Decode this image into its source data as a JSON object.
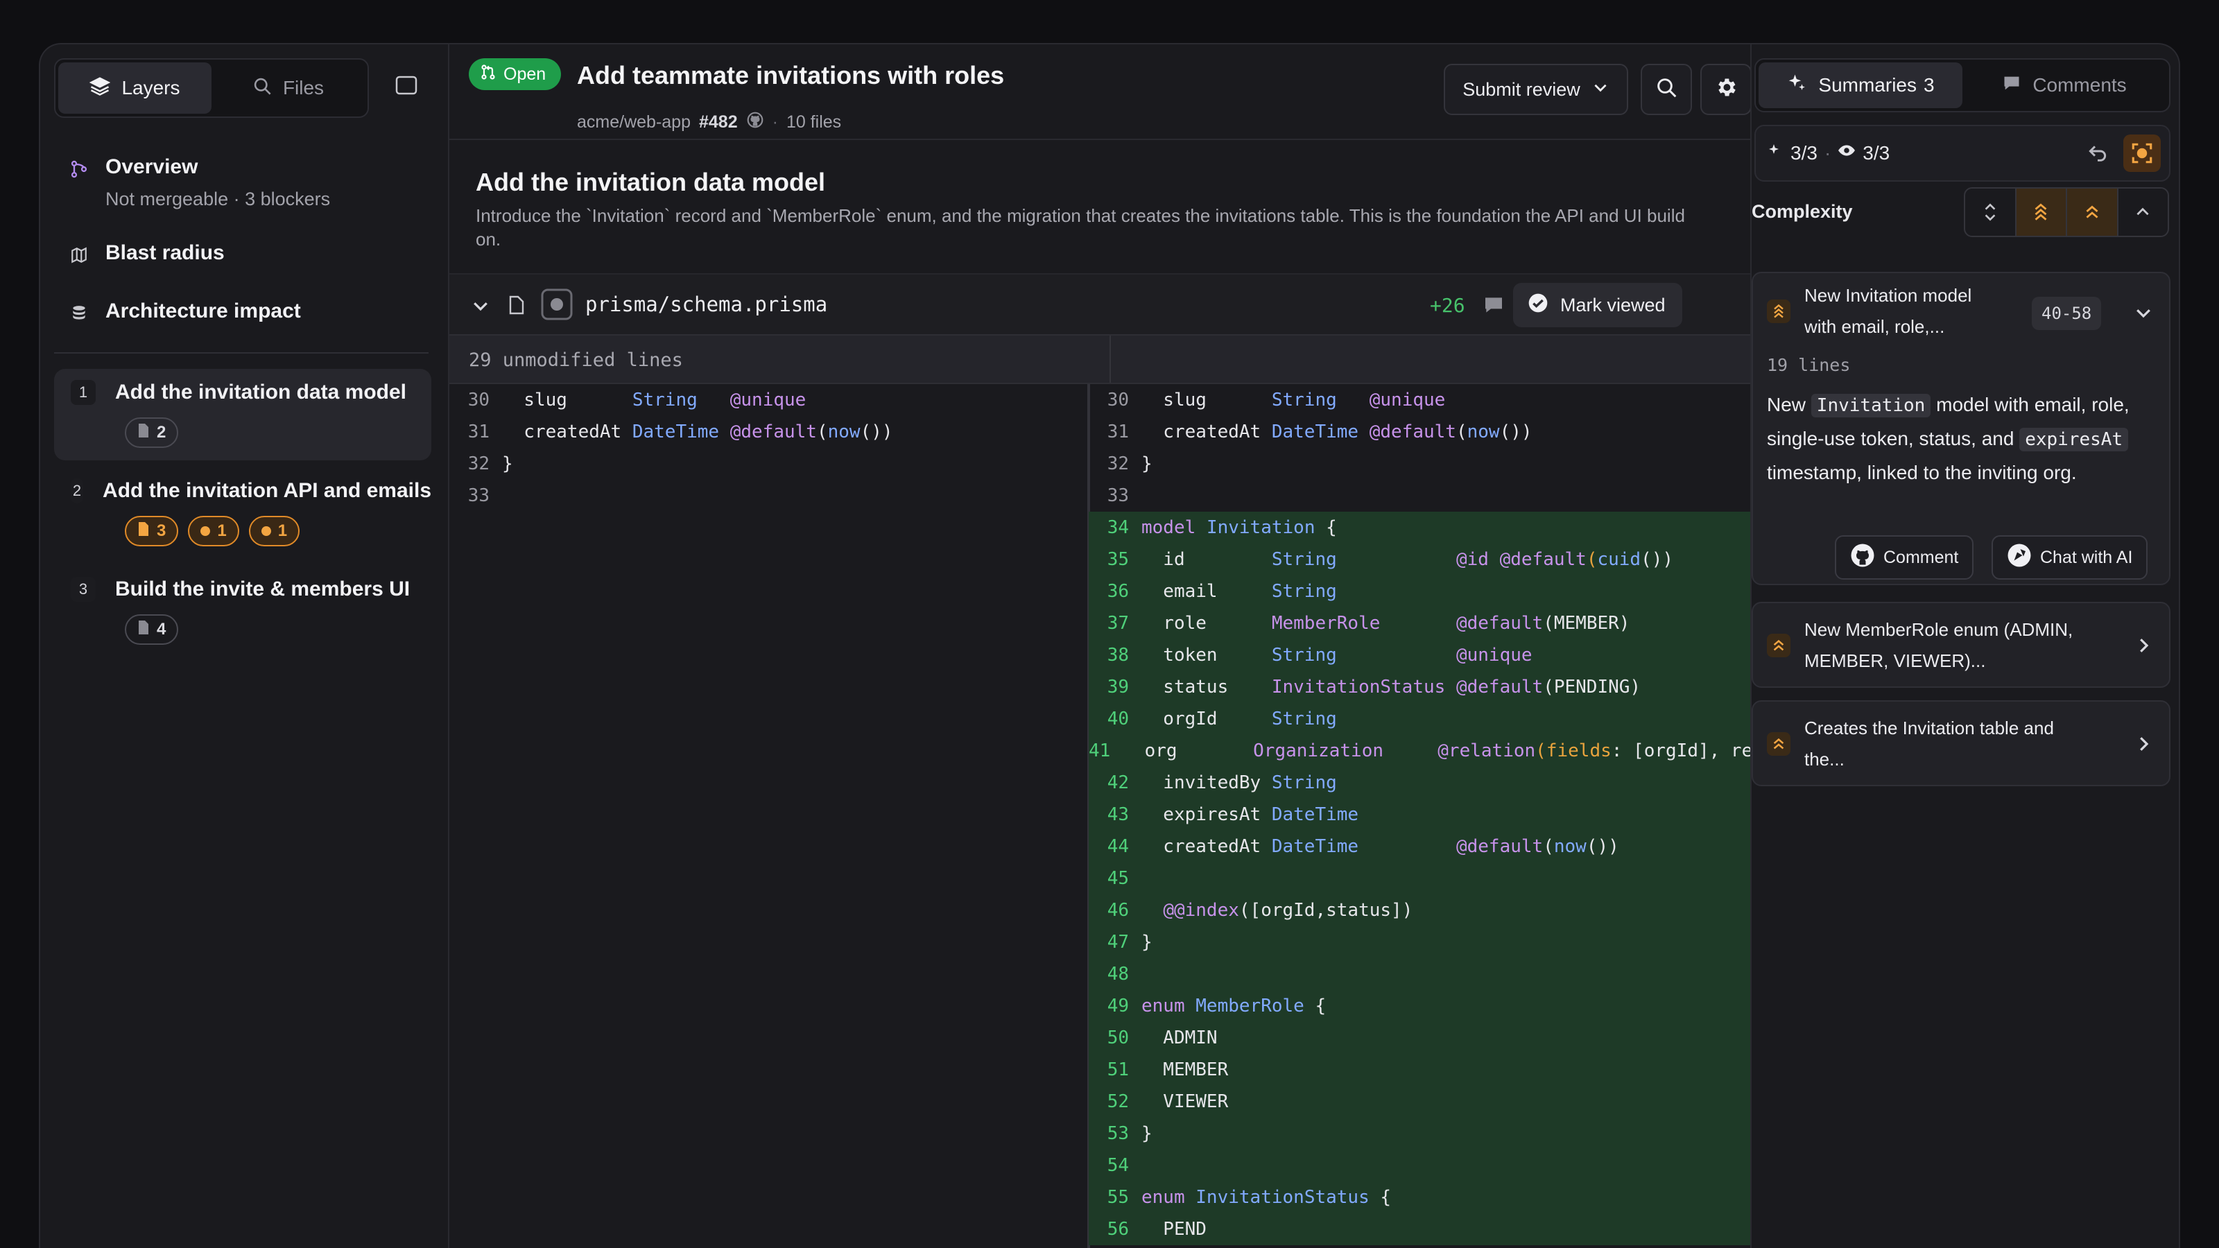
{
  "sidebar": {
    "tabs": [
      {
        "label": "Layers",
        "icon": "layers-icon"
      },
      {
        "label": "Files",
        "icon": "search-icon"
      }
    ],
    "nav": [
      {
        "title": "Overview",
        "subtitle": "Not mergeable · 3 blockers",
        "icon": "git-branch-icon"
      },
      {
        "title": "Blast radius",
        "icon": "map-icon"
      },
      {
        "title": "Architecture impact",
        "icon": "database-icon"
      }
    ],
    "layers": [
      {
        "num": "1",
        "title": "Add the invitation data model",
        "file_count": "2"
      },
      {
        "num": "2",
        "title": "Add the invitation API and emails",
        "file_count": "3",
        "warn_a": "1",
        "warn_b": "1"
      },
      {
        "num": "3",
        "title": "Build the invite & members UI",
        "file_count": "4"
      }
    ]
  },
  "header": {
    "status": "Open",
    "title": "Add teammate invitations with roles",
    "repo": "acme/web-app",
    "pr_number": "#482",
    "files": "10 files",
    "submit_label": "Submit review"
  },
  "section": {
    "title": "Add the invitation data model",
    "description": "Introduce the `Invitation` record and `MemberRole` enum, and the migration that creates the invitations table. This is the foundation the API and UI build on."
  },
  "file": {
    "path": "prisma/schema.prisma",
    "additions": "+26",
    "mark_viewed": "Mark viewed",
    "unmodified": "29 unmodified lines"
  },
  "diff_left": [
    {
      "n": "30",
      "parts": [
        [
          "p",
          "  slug      "
        ],
        [
          "t",
          "String"
        ],
        [
          "p",
          "   "
        ],
        [
          "a",
          "@unique"
        ]
      ]
    },
    {
      "n": "31",
      "parts": [
        [
          "p",
          "  createdAt "
        ],
        [
          "t",
          "DateTime"
        ],
        [
          "p",
          " "
        ],
        [
          "a",
          "@default"
        ],
        [
          "p",
          "("
        ],
        [
          "f",
          "now"
        ],
        [
          "p",
          "())"
        ]
      ]
    },
    {
      "n": "32",
      "parts": [
        [
          "p",
          "}"
        ]
      ]
    },
    {
      "n": "33",
      "parts": [
        [
          "p",
          ""
        ]
      ]
    }
  ],
  "diff_right": [
    {
      "n": "30",
      "add": false,
      "parts": [
        [
          "p",
          "  slug      "
        ],
        [
          "t",
          "String"
        ],
        [
          "p",
          "   "
        ],
        [
          "a",
          "@unique"
        ]
      ]
    },
    {
      "n": "31",
      "add": false,
      "parts": [
        [
          "p",
          "  createdAt "
        ],
        [
          "t",
          "DateTime"
        ],
        [
          "p",
          " "
        ],
        [
          "a",
          "@default"
        ],
        [
          "p",
          "("
        ],
        [
          "f",
          "now"
        ],
        [
          "p",
          "())"
        ]
      ]
    },
    {
      "n": "32",
      "add": false,
      "parts": [
        [
          "p",
          "}"
        ]
      ]
    },
    {
      "n": "33",
      "add": false,
      "parts": [
        [
          "p",
          ""
        ]
      ]
    },
    {
      "n": "34",
      "add": true,
      "parts": [
        [
          "k",
          "model"
        ],
        [
          "p",
          " "
        ],
        [
          "t",
          "Invitation"
        ],
        [
          "p",
          " {"
        ]
      ]
    },
    {
      "n": "35",
      "add": true,
      "parts": [
        [
          "p",
          "  id        "
        ],
        [
          "t",
          "String"
        ],
        [
          "p",
          "           "
        ],
        [
          "a",
          "@id"
        ],
        [
          "p",
          " "
        ],
        [
          "a",
          "@default"
        ],
        [
          "o",
          "("
        ],
        [
          "f",
          "cuid"
        ],
        [
          "p",
          "())"
        ]
      ]
    },
    {
      "n": "36",
      "add": true,
      "parts": [
        [
          "p",
          "  email     "
        ],
        [
          "t",
          "String"
        ]
      ]
    },
    {
      "n": "37",
      "add": true,
      "parts": [
        [
          "p",
          "  role      "
        ],
        [
          "k",
          "MemberRole"
        ],
        [
          "p",
          "       "
        ],
        [
          "a",
          "@default"
        ],
        [
          "p",
          "(MEMBER)"
        ]
      ]
    },
    {
      "n": "38",
      "add": true,
      "parts": [
        [
          "p",
          "  token     "
        ],
        [
          "t",
          "String"
        ],
        [
          "p",
          "           "
        ],
        [
          "a",
          "@unique"
        ]
      ]
    },
    {
      "n": "39",
      "add": true,
      "parts": [
        [
          "p",
          "  status    "
        ],
        [
          "k",
          "InvitationStatus"
        ],
        [
          "p",
          " "
        ],
        [
          "a",
          "@default"
        ],
        [
          "p",
          "(PENDING)"
        ]
      ]
    },
    {
      "n": "40",
      "add": true,
      "parts": [
        [
          "p",
          "  orgId     "
        ],
        [
          "t",
          "String"
        ]
      ]
    },
    {
      "n": "41",
      "add": true,
      "parts": [
        [
          "p",
          "  org       "
        ],
        [
          "k",
          "Organization"
        ],
        [
          "p",
          "     "
        ],
        [
          "a",
          "@relation"
        ],
        [
          "o",
          "("
        ],
        [
          "o",
          "fields"
        ],
        [
          "p",
          ": [orgId], references: [id])"
        ]
      ]
    },
    {
      "n": "42",
      "add": true,
      "parts": [
        [
          "p",
          "  invitedBy "
        ],
        [
          "t",
          "String"
        ]
      ]
    },
    {
      "n": "43",
      "add": true,
      "parts": [
        [
          "p",
          "  expiresAt "
        ],
        [
          "t",
          "DateTime"
        ]
      ]
    },
    {
      "n": "44",
      "add": true,
      "parts": [
        [
          "p",
          "  createdAt "
        ],
        [
          "t",
          "DateTime"
        ],
        [
          "p",
          "         "
        ],
        [
          "a",
          "@default"
        ],
        [
          "p",
          "("
        ],
        [
          "f",
          "now"
        ],
        [
          "p",
          "())"
        ]
      ]
    },
    {
      "n": "45",
      "add": true,
      "parts": [
        [
          "p",
          ""
        ]
      ]
    },
    {
      "n": "46",
      "add": true,
      "parts": [
        [
          "p",
          "  "
        ],
        [
          "a",
          "@@index"
        ],
        [
          "p",
          "([orgId,status])"
        ]
      ]
    },
    {
      "n": "47",
      "add": true,
      "parts": [
        [
          "p",
          "}"
        ]
      ]
    },
    {
      "n": "48",
      "add": true,
      "parts": [
        [
          "p",
          ""
        ]
      ]
    },
    {
      "n": "49",
      "add": true,
      "parts": [
        [
          "k",
          "enum"
        ],
        [
          "p",
          " "
        ],
        [
          "t",
          "MemberRole"
        ],
        [
          "p",
          " {"
        ]
      ]
    },
    {
      "n": "50",
      "add": true,
      "parts": [
        [
          "p",
          "  ADMIN"
        ]
      ]
    },
    {
      "n": "51",
      "add": true,
      "parts": [
        [
          "p",
          "  MEMBER"
        ]
      ]
    },
    {
      "n": "52",
      "add": true,
      "parts": [
        [
          "p",
          "  VIEWER"
        ]
      ]
    },
    {
      "n": "53",
      "add": true,
      "parts": [
        [
          "p",
          "}"
        ]
      ]
    },
    {
      "n": "54",
      "add": true,
      "parts": [
        [
          "p",
          ""
        ]
      ]
    },
    {
      "n": "55",
      "add": true,
      "parts": [
        [
          "k",
          "enum"
        ],
        [
          "p",
          " "
        ],
        [
          "t",
          "InvitationStatus"
        ],
        [
          "p",
          " {"
        ]
      ]
    },
    {
      "n": "56",
      "add": true,
      "parts": [
        [
          "p",
          "  PEND"
        ]
      ]
    }
  ],
  "right_panel": {
    "tabs": [
      {
        "label": "Summaries",
        "count": "3"
      },
      {
        "label": "Comments"
      }
    ],
    "stat_a": "3/3",
    "stat_b": "3/3",
    "complexity_label": "Complexity",
    "summaries": [
      {
        "title_1": "New Invitation model",
        "title_2": "with email, role,...",
        "range": "40-58",
        "lines": "19 lines",
        "body_pre": "New ",
        "code_1": "Invitation",
        "body_mid": " model with email, role, single-use token, status, and ",
        "code_2": "expiresAt",
        "body_post": " timestamp, linked to the inviting org.",
        "comment_label": "Comment",
        "chat_label": "Chat with AI"
      },
      {
        "title_1": "New MemberRole enum (ADMIN,",
        "title_2": "MEMBER, VIEWER)..."
      },
      {
        "title_1": "Creates the Invitation table and",
        "title_2": "the..."
      }
    ]
  },
  "colors": {
    "accent_green": "#1f9d4a",
    "accent_orange": "#e8963a",
    "added_bg": "#1e3a27"
  }
}
